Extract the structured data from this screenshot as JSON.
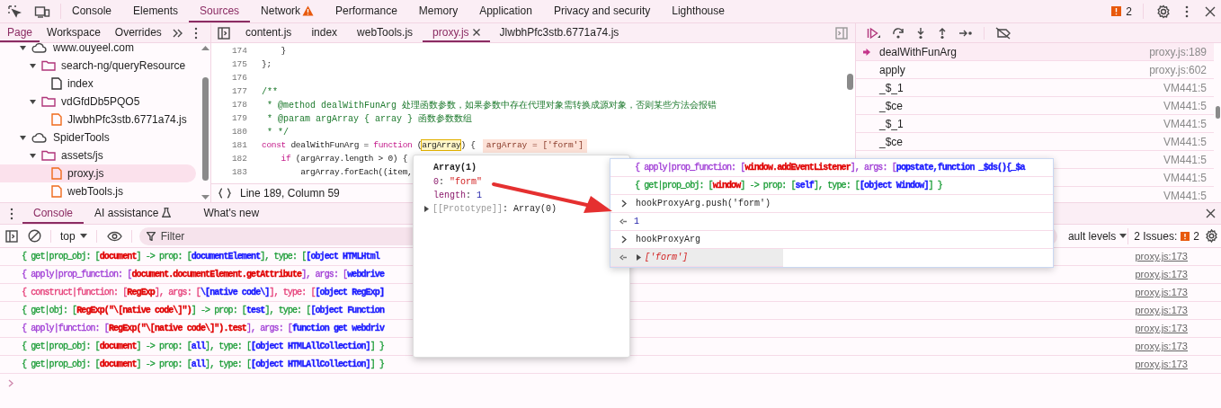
{
  "main_tabs": [
    {
      "label": "Console",
      "selected": false,
      "warning": false
    },
    {
      "label": "Elements",
      "selected": false,
      "warning": false
    },
    {
      "label": "Sources",
      "selected": true,
      "warning": false
    },
    {
      "label": "Network",
      "selected": false,
      "warning": true
    },
    {
      "label": "Performance",
      "selected": false,
      "warning": false
    },
    {
      "label": "Memory",
      "selected": false,
      "warning": false
    },
    {
      "label": "Application",
      "selected": false,
      "warning": false
    },
    {
      "label": "Privacy and security",
      "selected": false,
      "warning": false
    },
    {
      "label": "Lighthouse",
      "selected": false,
      "warning": false
    }
  ],
  "issues_count": "2",
  "navigator_tabs": [
    {
      "label": "Page",
      "selected": true
    },
    {
      "label": "Workspace",
      "selected": false
    },
    {
      "label": "Overrides",
      "selected": false
    }
  ],
  "file_tabs": [
    {
      "label": "content.js",
      "selected": false
    },
    {
      "label": "index",
      "selected": false
    },
    {
      "label": "webTools.js",
      "selected": false
    },
    {
      "label": "proxy.js",
      "selected": true
    },
    {
      "label": "JlwbhPfc3stb.6771a74.js",
      "selected": false
    }
  ],
  "file_tree": [
    {
      "label": "www.ouyeel.com",
      "kind": "domain",
      "expanded": true,
      "selected": false,
      "children": [
        {
          "label": "search-ng/queryResource",
          "kind": "folder",
          "expanded": true,
          "selected": false,
          "children": [
            {
              "label": "index",
              "kind": "document",
              "selected": false
            }
          ]
        },
        {
          "label": "vdGfdDb5PQO5",
          "kind": "folder",
          "expanded": true,
          "selected": false,
          "children": [
            {
              "label": "JlwbhPfc3stb.6771a74.js",
              "kind": "script",
              "selected": false
            }
          ]
        }
      ]
    },
    {
      "label": "SpiderTools",
      "kind": "domain",
      "expanded": true,
      "selected": false,
      "children": [
        {
          "label": "assets/js",
          "kind": "folder",
          "expanded": true,
          "selected": false,
          "children": [
            {
              "label": "proxy.js",
              "kind": "script",
              "selected": true
            },
            {
              "label": "webTools.js",
              "kind": "script",
              "selected": false
            }
          ]
        }
      ]
    }
  ],
  "code": {
    "lines": [
      {
        "number": "174",
        "segments": [
          {
            "text": "    }",
            "kind": "plain"
          }
        ]
      },
      {
        "number": "175",
        "segments": [
          {
            "text": "};",
            "kind": "plain"
          }
        ]
      },
      {
        "number": "176"
      },
      {
        "number": "177",
        "segments": [
          {
            "text": "/**",
            "kind": "comment"
          }
        ]
      },
      {
        "number": "178",
        "segments": [
          {
            "text": " * @method dealWithFunArg 处理函数参数，如果参数中存在代理对象需转换成源对象，否则某些方法会报错",
            "kind": "comment"
          }
        ]
      },
      {
        "number": "179",
        "segments": [
          {
            "text": " * @param argArray { array } 函数参数数组",
            "kind": "comment"
          }
        ]
      },
      {
        "number": "180",
        "segments": [
          {
            "text": " * */",
            "kind": "comment"
          }
        ]
      },
      {
        "number": "181",
        "segments": [
          {
            "text": "const",
            "kind": "keyword"
          },
          {
            "text": " dealWithFunArg = ",
            "kind": "plain"
          },
          {
            "text": "function",
            "kind": "keyword"
          },
          {
            "text": " (",
            "kind": "plain"
          },
          {
            "text": "argArray",
            "kind": "highlight"
          },
          {
            "text": ") {",
            "kind": "plain"
          },
          {
            "text": "argArray = ['form']",
            "kind": "inline_value"
          }
        ]
      },
      {
        "number": "182",
        "segments": [
          {
            "text": "    if",
            "kind": "keyword"
          },
          {
            "text": " (argArray.length > 0) {",
            "kind": "plain"
          }
        ]
      },
      {
        "number": "183",
        "segments": [
          {
            "text": "        argArray.forEach((item,",
            "kind": "plain"
          }
        ]
      }
    ],
    "status": "Line 189, Column 59"
  },
  "call_stack": [
    {
      "function": "dealWithFunArg",
      "location": "proxy.js:189",
      "current": true
    },
    {
      "function": "apply",
      "location": "proxy.js:602",
      "current": false
    },
    {
      "function": "_$_1",
      "location": "VM441:5",
      "current": false
    },
    {
      "function": "_$ce",
      "location": "VM441:5",
      "current": false
    },
    {
      "function": "_$_1",
      "location": "VM441:5",
      "current": false
    },
    {
      "function": "_$ce",
      "location": "VM441:5",
      "current": false
    },
    {
      "location": "VM441:5",
      "current": false
    },
    {
      "location": "VM441:5"
    },
    {
      "location": "VM441:5"
    }
  ],
  "drawer_tabs": [
    {
      "label": "Console",
      "selected": true
    },
    {
      "label": "AI assistance",
      "selected": false
    },
    {
      "label": "What's new",
      "selected": false
    }
  ],
  "console_toolbar": {
    "context": "top",
    "filter_placeholder": "Filter",
    "levels": "ault levels",
    "issues_label": "2 Issues:",
    "issues_count": "2"
  },
  "console_messages": [
    {
      "color": "#1f9e3a",
      "location": "proxy.js:173",
      "segments": [
        {
          "text": "{ get|prop_obj: [",
          "kind": "plain"
        },
        {
          "text": "document",
          "kind": "object"
        },
        {
          "text": "] -> prop: [",
          "kind": "plain"
        },
        {
          "text": "documentElement",
          "kind": "value"
        },
        {
          "text": "], type: [",
          "kind": "plain"
        },
        {
          "text": "[object HTMLHtml",
          "kind": "value"
        }
      ]
    },
    {
      "color": "#a13fd6",
      "location": "proxy.js:173",
      "segments": [
        {
          "text": "{ apply|prop_function: [",
          "kind": "plain"
        },
        {
          "text": "document.documentElement.getAttribute",
          "kind": "object"
        },
        {
          "text": "], args: [",
          "kind": "plain"
        },
        {
          "text": "webdrive",
          "kind": "value"
        }
      ]
    },
    {
      "color": "#e6407a",
      "location": "proxy.js:173",
      "segments": [
        {
          "text": "{ construct|function: [",
          "kind": "plain"
        },
        {
          "text": "RegExp",
          "kind": "object"
        },
        {
          "text": "], args: [",
          "kind": "plain"
        },
        {
          "text": "\\[native code\\]",
          "kind": "value"
        },
        {
          "text": "], type: [",
          "kind": "plain"
        },
        {
          "text": "[object RegExp]",
          "kind": "value"
        }
      ]
    },
    {
      "color": "#1f9e3a",
      "location": "proxy.js:173",
      "segments": [
        {
          "text": "{ get|obj: [",
          "kind": "plain"
        },
        {
          "text": "RegExp(\"\\[native code\\]\")",
          "kind": "object"
        },
        {
          "text": "] -> prop: [",
          "kind": "plain"
        },
        {
          "text": "test",
          "kind": "value"
        },
        {
          "text": "], type: [",
          "kind": "plain"
        },
        {
          "text": "[object Function",
          "kind": "value"
        }
      ]
    },
    {
      "color": "#a13fd6",
      "location": "proxy.js:173",
      "segments": [
        {
          "text": "{ apply|function: [",
          "kind": "plain"
        },
        {
          "text": "RegExp(\"\\[native code\\]\").test",
          "kind": "object"
        },
        {
          "text": "], args: [",
          "kind": "plain"
        },
        {
          "text": "function get webdriv",
          "kind": "value"
        }
      ]
    },
    {
      "color": "#1f9e3a",
      "location": "proxy.js:173",
      "segments": [
        {
          "text": "{ get|prop_obj: [",
          "kind": "plain"
        },
        {
          "text": "document",
          "kind": "object"
        },
        {
          "text": "] -> prop: [",
          "kind": "plain"
        },
        {
          "text": "all",
          "kind": "value"
        },
        {
          "text": "], type: [",
          "kind": "plain"
        },
        {
          "text": "[object HTMLAllCollection]",
          "kind": "value"
        },
        {
          "text": "] }",
          "kind": "plain"
        }
      ]
    },
    {
      "color": "#1f9e3a",
      "location": "proxy.js:173",
      "segments": [
        {
          "text": "{ get|prop_obj: [",
          "kind": "plain"
        },
        {
          "text": "document",
          "kind": "object"
        },
        {
          "text": "] -> prop: [",
          "kind": "plain"
        },
        {
          "text": "all",
          "kind": "value"
        },
        {
          "text": "], type: [",
          "kind": "plain"
        },
        {
          "text": "[object HTMLAllCollection]",
          "kind": "value"
        },
        {
          "text": "] }",
          "kind": "plain"
        }
      ]
    }
  ],
  "value_popover": {
    "title": "Array(1)",
    "properties": [
      {
        "key": "0",
        "separator": ": ",
        "value": "\"form\"",
        "kind": "string"
      },
      {
        "key": "length",
        "separator": ": ",
        "value": "1",
        "kind": "number"
      }
    ],
    "prototype_key": "[[Prototype]]",
    "prototype_value": ": Array(0)"
  },
  "console_popup": {
    "entries": [
      {
        "kind": "log",
        "color": "#a13fd6",
        "segments": [
          {
            "text": "{ apply|prop_function: [",
            "kind": "plain"
          },
          {
            "text": "window.addEventListener",
            "kind": "object"
          },
          {
            "text": "], args: [",
            "kind": "plain"
          },
          {
            "text": "popstate,function _$ds(){_$a",
            "kind": "value"
          }
        ]
      },
      {
        "kind": "log",
        "color": "#1f9e3a",
        "segments": [
          {
            "text": "{ get|prop_obj: [",
            "kind": "plain"
          },
          {
            "text": "window",
            "kind": "object"
          },
          {
            "text": "] -> prop: [",
            "kind": "plain"
          },
          {
            "text": "self",
            "kind": "value"
          },
          {
            "text": "], type: [",
            "kind": "plain"
          },
          {
            "text": "[object Window]",
            "kind": "value"
          },
          {
            "text": "] }",
            "kind": "plain"
          }
        ]
      },
      {
        "kind": "input",
        "text": "hookProxyArg.push('form')"
      },
      {
        "kind": "result",
        "text": "1"
      },
      {
        "kind": "input",
        "text": "hookProxyArg"
      },
      {
        "kind": "result_object",
        "text": "['form']"
      }
    ]
  }
}
